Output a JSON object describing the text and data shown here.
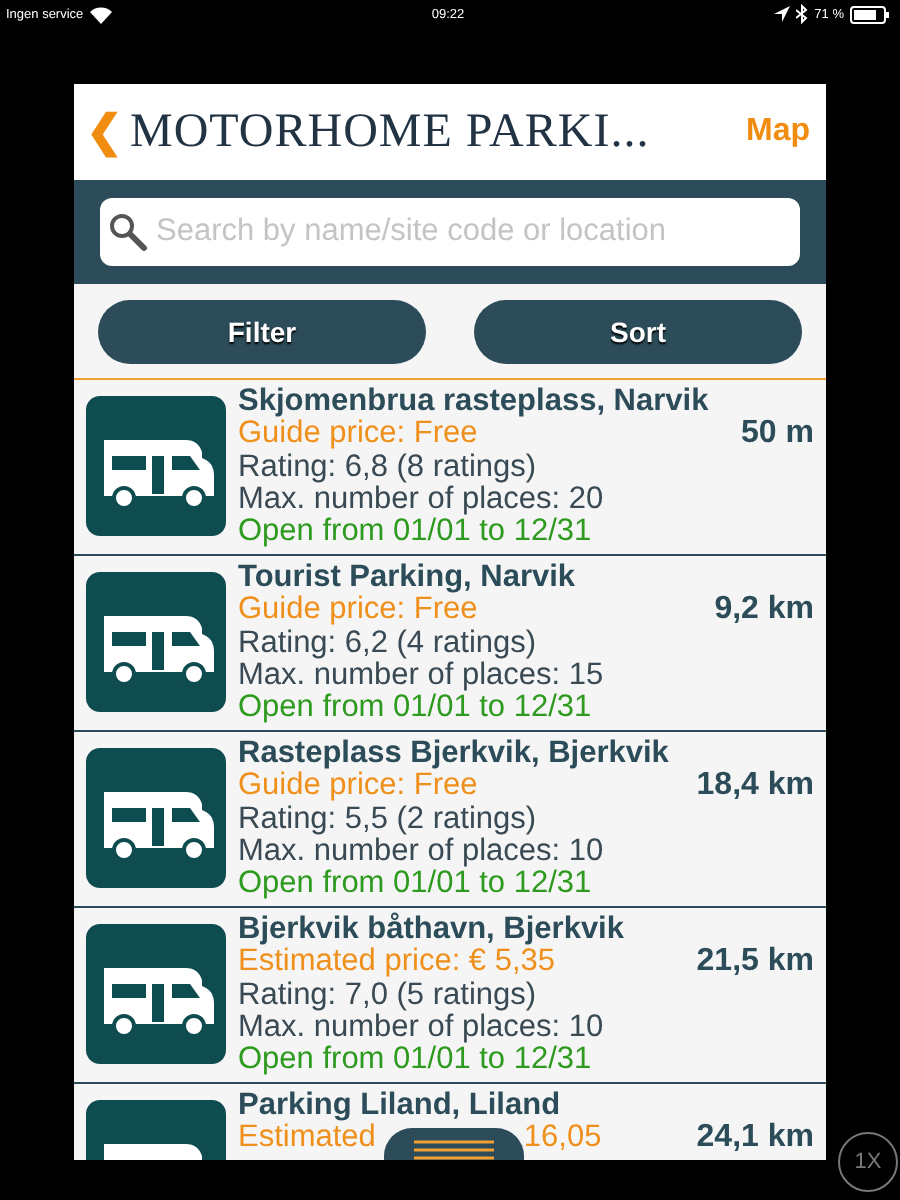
{
  "status_bar": {
    "carrier": "Ingen service",
    "time": "09:22",
    "battery": "71 %"
  },
  "header": {
    "back": "❮",
    "title": "MOTORHOME PARKI...",
    "map": "Map"
  },
  "search": {
    "placeholder": "Search by name/site code or location"
  },
  "buttons": [
    "Filter",
    "Sort"
  ],
  "sites": [
    {
      "name": "Skjomenbrua rasteplass, Narvik",
      "price": "Guide price: Free",
      "rating": "Rating: 6,8 (8 ratings)",
      "places": "Max. number of places: 20",
      "open": "Open from 01/01 to 12/31",
      "distance": "50 m"
    },
    {
      "name": "Tourist Parking, Narvik",
      "price": "Guide price: Free",
      "rating": "Rating: 6,2 (4 ratings)",
      "places": "Max. number of places: 15",
      "open": "Open from 01/01 to 12/31",
      "distance": "9,2 km"
    },
    {
      "name": "Rasteplass Bjerkvik, Bjerkvik",
      "price": "Guide price: Free",
      "rating": "Rating: 5,5 (2 ratings)",
      "places": "Max. number of places: 10",
      "open": "Open from 01/01 to 12/31",
      "distance": "18,4 km"
    },
    {
      "name": "Bjerkvik båthavn, Bjerkvik",
      "price": "Estimated price: € 5,35",
      "rating": "Rating: 7,0 (5 ratings)",
      "places": "Max. number of places: 10",
      "open": "Open from 01/01 to 12/31",
      "distance": "21,5 km"
    },
    {
      "name": "Parking Liland, Liland",
      "price": "Estimated",
      "price_tail": "16,05",
      "distance": "24,1 km"
    }
  ],
  "zoom_button": "1X"
}
